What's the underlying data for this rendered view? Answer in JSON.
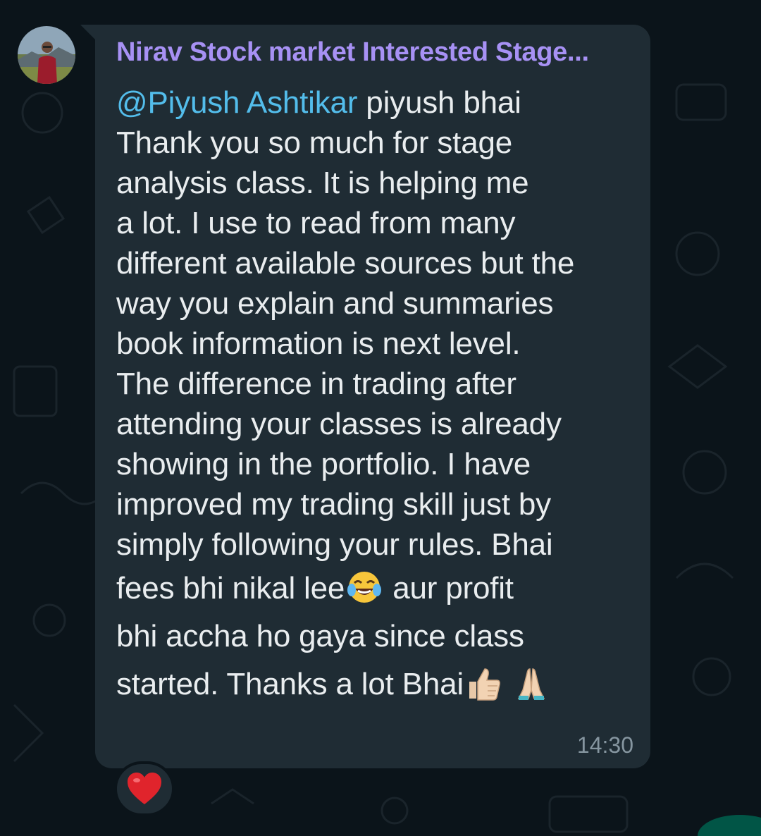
{
  "chat": {
    "sender_name": "Nirav Stock market Interested Stage...",
    "mention": "@Piyush Ashtikar",
    "lines": [
      " piyush bhai",
      "Thank you so much for stage",
      "analysis class. It is helping me",
      "a lot. I use to read from many",
      "different available sources but the",
      "way you explain and summaries",
      "book information is next level.",
      "The difference in trading after",
      "attending your classes is already",
      "showing in the portfolio. I have",
      "improved my trading skill just by",
      "simply following your rules. Bhai"
    ],
    "line_fees_a": "fees bhi nikal lee",
    "line_fees_b": " aur profit",
    "line_accha": "bhi accha ho gaya since class",
    "line_started": "started. Thanks a lot Bhai",
    "time": "14:30"
  },
  "icons": {
    "avatar": "avatar-photo",
    "laugh": "face-with-tears-of-joy-icon",
    "thumbs": "thumbs-up-icon",
    "pray": "folded-hands-icon",
    "reaction": "red-heart-icon"
  },
  "colors": {
    "background": "#0b141a",
    "bubble": "#1f2c34",
    "sender": "#a791f4",
    "mention": "#53bdeb",
    "text": "#e9edef",
    "time": "#8696a0",
    "heart": "#e0242c"
  }
}
